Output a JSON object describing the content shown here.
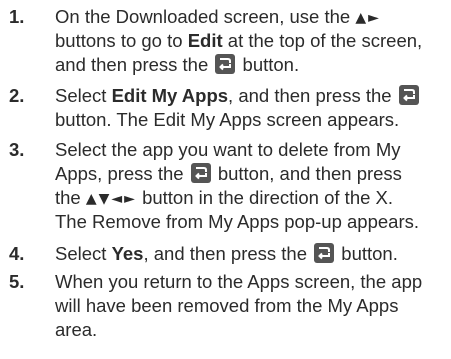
{
  "steps": [
    {
      "number": "1.",
      "line1_a": "On the Downloaded screen, use the ",
      "line1_arrows": "▲►",
      "line2_a": "buttons to go to ",
      "line2_bold": "Edit",
      "line2_b": " at the top of the screen,",
      "line3_a": "and then press the ",
      "line3_b": " button."
    },
    {
      "number": "2.",
      "line1_a": "Select ",
      "line1_bold": "Edit My Apps",
      "line1_b": ", and then press the ",
      "line2_a": "button. The Edit My Apps screen appears."
    },
    {
      "number": "3.",
      "line1_a": "Select the app you want to delete from My",
      "line2_a": "Apps, press the ",
      "line2_b": " button, and then press",
      "line3_a": "the ",
      "line3_arrows": "▲▼◄►",
      "line3_b": " button in the direction of the X.",
      "line4_a": "The Remove from My Apps pop-up appears."
    },
    {
      "number": "4.",
      "line1_a": "Select ",
      "line1_bold": "Yes",
      "line1_b": ", and then press the ",
      "line1_c": " button."
    },
    {
      "number": "5.",
      "line1_a": "When you return to the Apps screen, the app",
      "line2_a": "will have been removed from the My Apps",
      "line3_a": "area."
    }
  ],
  "icons": {
    "enter_button": "enter-button-icon",
    "icon_bg": "#555555"
  }
}
